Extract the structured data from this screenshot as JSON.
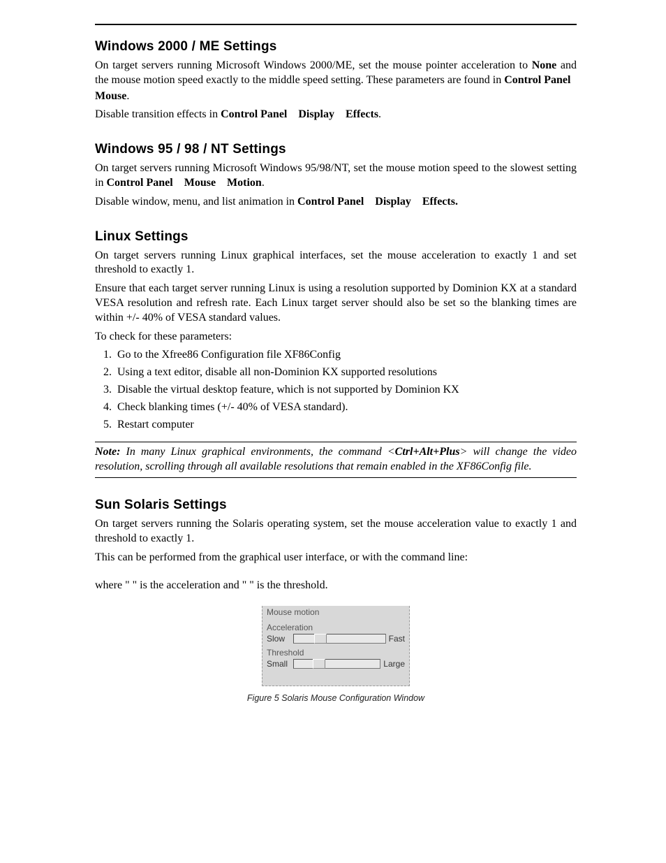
{
  "sections": {
    "win2k": {
      "heading": "Windows 2000 / ME Settings",
      "p1_a": "On target servers running Microsoft Windows 2000/ME, set the mouse pointer acceleration to ",
      "p1_b_bold": "None",
      "p1_c": " and the mouse motion speed exactly to the middle speed setting. These parameters are found in ",
      "p1_d_bold": "Control Panel",
      "p1_e_bold": "Mouse",
      "p1_dot": ".",
      "p2_a": "Disable transition effects in ",
      "p2_b_bold": "Control Panel",
      "p2_c_bold": "Display",
      "p2_d_bold": "Effects",
      "p2_end": "."
    },
    "win95": {
      "heading": "Windows 95 / 98 / NT Settings",
      "p1_a": "On target servers running Microsoft Windows 95/98/NT, set the mouse motion speed to the slowest setting in ",
      "p1_b_bold": "Control Panel",
      "p1_c_bold": "Mouse",
      "p1_d_bold": "Motion",
      "p1_end": ".",
      "p2_a": "Disable window, menu, and list animation in ",
      "p2_b_bold": "Control Panel",
      "p2_c_bold": "Display",
      "p2_d_bold": "Effects."
    },
    "linux": {
      "heading": "Linux Settings",
      "p1": "On target servers running Linux graphical interfaces, set the mouse acceleration to exactly 1 and set threshold to exactly 1.",
      "p2": "Ensure that each target server running Linux is using a resolution supported by Dominion KX at a standard VESA resolution and refresh rate. Each Linux target server should also be set so the blanking times are within +/- 40% of VESA standard values.",
      "p3": "To check for these parameters:",
      "steps": [
        "Go to the Xfree86 Configuration file XF86Config",
        "Using a text editor, disable all non-Dominion KX supported resolutions",
        "Disable the virtual desktop feature, which is not supported by Dominion KX",
        "Check blanking times (+/- 40% of VESA standard).",
        "Restart computer"
      ],
      "note_a": "Note:",
      "note_b": " In many Linux graphical environments, the command <",
      "note_c_cmd": "Ctrl+Alt+Plus",
      "note_d": "> will change the video resolution, scrolling through all available resolutions that remain enabled in the XF86Config file."
    },
    "solaris": {
      "heading": "Sun Solaris Settings",
      "p1": "On target servers running the Solaris operating system, set the mouse acceleration value to exactly 1 and threshold to exactly 1.",
      "p2": "This can be performed from the graphical user interface, or with the command line:",
      "p3": "where \"  \" is the acceleration and \"  \" is the threshold."
    }
  },
  "figure": {
    "group_label": "Mouse motion",
    "accel_label": "Acceleration",
    "accel_slow": "Slow",
    "accel_fast": "Fast",
    "thresh_label": "Threshold",
    "thresh_small": "Small",
    "thresh_large": "Large",
    "caption": "Figure 5 Solaris Mouse Configuration Window"
  }
}
